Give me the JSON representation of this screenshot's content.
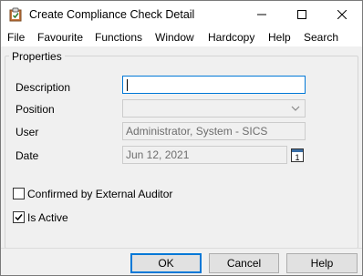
{
  "window": {
    "title": "Create Compliance Check Detail",
    "icons": {
      "app": "clipboard-check-icon",
      "minimize": "minimize-icon",
      "maximize": "maximize-icon",
      "close": "close-icon"
    }
  },
  "menu": {
    "items": [
      "File",
      "Favourite",
      "Functions",
      "Window",
      "Hardcopy",
      "Help",
      "Search"
    ]
  },
  "properties": {
    "group_title": "Properties",
    "description": {
      "label": "Description",
      "value": ""
    },
    "position": {
      "label": "Position",
      "value": ""
    },
    "user": {
      "label": "User",
      "value": "Administrator, System - SICS"
    },
    "date": {
      "label": "Date",
      "value": "Jun 12, 2021",
      "icon": "calendar-icon"
    },
    "confirmed": {
      "label": "Confirmed by External Auditor",
      "checked": false
    },
    "is_active": {
      "label": "Is Active",
      "checked": true
    }
  },
  "buttons": {
    "ok": "OK",
    "cancel": "Cancel",
    "help": "Help"
  },
  "colors": {
    "focus": "#0078d7",
    "background": "#f0f0f0"
  }
}
